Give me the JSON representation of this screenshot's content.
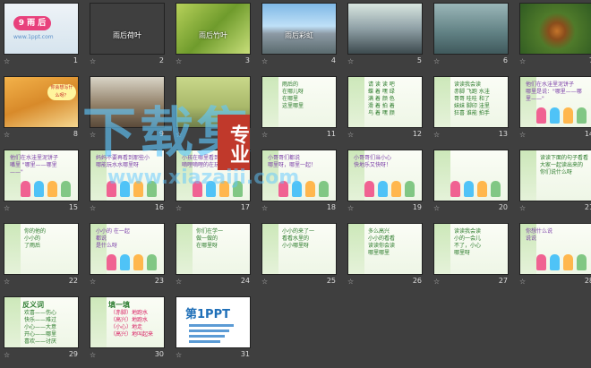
{
  "slides": [
    {
      "n": "1",
      "type": "title",
      "title": "9 雨 后",
      "url": "www.1ppt.com"
    },
    {
      "n": "2",
      "type": "photo",
      "bg": "linear-gradient(160deg,#3f7d34,#8fc474 55,#2e5f2a)",
      "caption": "雨后荷叶"
    },
    {
      "n": "3",
      "type": "photo",
      "bg": "linear-gradient(135deg,#b7d15a,#6f9b2c 50%,#c8df7a)",
      "caption": "雨后竹叶"
    },
    {
      "n": "4",
      "type": "photo",
      "bg": "linear-gradient(180deg,#7fb8e6 0,#bfe0f7 45%,#8d9aa5 60%,#5a6b6e)",
      "caption": "雨后彩虹"
    },
    {
      "n": "5",
      "type": "photo",
      "bg": "linear-gradient(180deg,#d8e6e0,#8fa0a6 50%,#3d4a4e)"
    },
    {
      "n": "6",
      "type": "photo",
      "bg": "linear-gradient(180deg,#9ab6b8,#5f7f82 60%,#40595c)"
    },
    {
      "n": "7",
      "type": "photo",
      "bg": "radial-gradient(circle at 50% 55%,#c4742a 0,#8a4d1c 18%,#4f7a2a 40%,#2f5a22)"
    },
    {
      "n": "8",
      "type": "photo",
      "bg": "linear-gradient(160deg,#f3b24a,#d88a2a 50%,#f5d790)",
      "bubble": "你会想写什么呀？"
    },
    {
      "n": "9",
      "type": "photo",
      "bg": "linear-gradient(180deg,#d9d4c6,#8c7a62 60%,#5a4a3a)"
    },
    {
      "n": "10",
      "type": "photo",
      "bg": "linear-gradient(180deg,#c9d88a,#a9b86a 60%,#6e7d4a)"
    },
    {
      "n": "11",
      "type": "text",
      "lines": [
        "雨后的",
        "在哪儿呀",
        "在哪里",
        "这里哪里"
      ]
    },
    {
      "n": "12",
      "type": "text",
      "lines": [
        "请 读 读 吧",
        "蝶 着 嘿 绿",
        "满 着 颜 色",
        "滑 着 拍 着",
        "鸟 着 嘿 颜"
      ]
    },
    {
      "n": "13",
      "type": "text",
      "lines": [
        "读读我会读",
        "赤脚 飞跑 水洼",
        "哥哥 哇哇 和了",
        "妹妹 脚印 洼里",
        "狂喜 谁能 拍手"
      ]
    },
    {
      "n": "14",
      "type": "kids",
      "lines": [
        "他们在水洼里泥饼子",
        "哪里是说：\"哪里——哪",
        "里——\""
      ]
    },
    {
      "n": "15",
      "type": "kids",
      "lines": [
        "他们在水洼里泥饼子",
        "嘴里 \"哪里——哪里",
        "——\""
      ]
    },
    {
      "n": "16",
      "type": "kids",
      "lines": [
        "妈妈不要再看到那些小",
        "哪能玩水水哪里呀"
      ]
    },
    {
      "n": "17",
      "type": "kids",
      "lines": [
        "小孩在哪里看到",
        "嘀哩嘀哩的在玩"
      ]
    },
    {
      "n": "18",
      "type": "kids",
      "lines": [
        "小哥哥们都说",
        "哪里呀，哪里一起！"
      ]
    },
    {
      "n": "19",
      "type": "kids",
      "lines": [
        "小哥哥们当小心",
        "快地乐又快呀！"
      ]
    },
    {
      "n": "20",
      "type": "kids",
      "lines": []
    },
    {
      "n": "21",
      "type": "text",
      "lines": [
        "读读下面的句子看看",
        "大家一起读出来的",
        "你们说什么呀"
      ]
    },
    {
      "n": "22",
      "type": "text",
      "lines": [
        "你的他的",
        "小小的",
        "了雨后"
      ]
    },
    {
      "n": "23",
      "type": "kids",
      "lines": [
        "小小的 在一起",
        "都说",
        "是什么呀"
      ]
    },
    {
      "n": "24",
      "type": "text",
      "lines": [
        "你们在学一",
        "做一做的",
        "在哪里呀"
      ]
    },
    {
      "n": "25",
      "type": "text",
      "lines": [
        "小小的来了一",
        "看看水里的",
        "小小哪里呀"
      ]
    },
    {
      "n": "26",
      "type": "text",
      "lines": [
        "多么高兴",
        "小小的看看",
        "读读你会读",
        "哪里哪里"
      ]
    },
    {
      "n": "27",
      "type": "text",
      "lines": [
        "读读我会读",
        "小的一会儿",
        "不了，小心",
        "哪里呀"
      ]
    },
    {
      "n": "28",
      "type": "kids",
      "lines": [
        "你想什么说",
        "说说"
      ]
    },
    {
      "n": "29",
      "type": "antonym",
      "title": "反义词",
      "lines": [
        "欢喜——伤心",
        "快乐——难过",
        "小心——大意",
        "开心——哪里",
        "喜欢——讨厌"
      ]
    },
    {
      "n": "30",
      "type": "fill",
      "title": "填一填",
      "lines": [
        "（赤脚）地跑水",
        "（高兴）地跑水",
        "（小心）地走",
        "（高兴）地叫起来"
      ]
    },
    {
      "n": "31",
      "type": "logo",
      "logo": "第1PPT"
    }
  ],
  "watermark": {
    "main": "下载集",
    "badge": "专业",
    "url": "www.xiazaiji.com"
  }
}
